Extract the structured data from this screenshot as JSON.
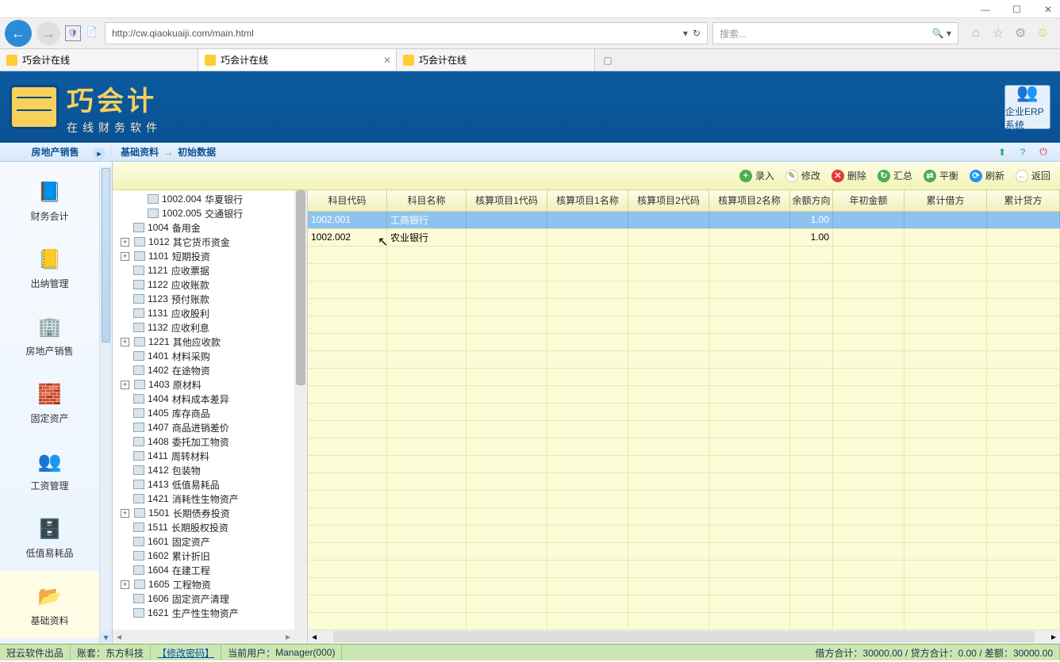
{
  "window": {
    "url": "http://cw.qiaokuaiji.com/main.html",
    "search_placeholder": "搜索..."
  },
  "tabs": [
    {
      "title": "巧会计在线",
      "active": false
    },
    {
      "title": "巧会计在线",
      "active": true
    },
    {
      "title": "巧会计在线",
      "active": false
    }
  ],
  "app": {
    "logo_main": "巧会计",
    "logo_sub": "在线财务软件",
    "erp_label": "企业ERP系统"
  },
  "module": "房地产销售",
  "breadcrumb": {
    "root": "基础资料",
    "leaf": "初始数据"
  },
  "left_nav": [
    {
      "label": "财务会计",
      "icon": "📘"
    },
    {
      "label": "出纳管理",
      "icon": "📒"
    },
    {
      "label": "房地产销售",
      "icon": "🏢"
    },
    {
      "label": "固定资产",
      "icon": "🧱"
    },
    {
      "label": "工资管理",
      "icon": "👥"
    },
    {
      "label": "低值易耗品",
      "icon": "🗄️"
    },
    {
      "label": "基础资料",
      "icon": "📂",
      "active": true
    }
  ],
  "toolbar": [
    {
      "label": "录入",
      "color": "green",
      "glyph": "+"
    },
    {
      "label": "修改",
      "color": "yel",
      "glyph": "✎"
    },
    {
      "label": "删除",
      "color": "red",
      "glyph": "✕"
    },
    {
      "label": "汇总",
      "color": "grn2",
      "glyph": "↻"
    },
    {
      "label": "平衡",
      "color": "grn2",
      "glyph": "⇄"
    },
    {
      "label": "刷新",
      "color": "blue",
      "glyph": "⟳"
    },
    {
      "label": "返回",
      "color": "yel",
      "glyph": "←"
    }
  ],
  "tree": [
    {
      "level": 2,
      "code": "1002.004",
      "name": "华夏银行"
    },
    {
      "level": 2,
      "code": "1002.005",
      "name": "交通银行"
    },
    {
      "level": 1,
      "code": "1004",
      "name": "备用金"
    },
    {
      "level": 1,
      "code": "1012",
      "name": "其它货币资金",
      "exp": "+"
    },
    {
      "level": 1,
      "code": "1101",
      "name": "短期投资",
      "exp": "+"
    },
    {
      "level": 1,
      "code": "1121",
      "name": "应收票据"
    },
    {
      "level": 1,
      "code": "1122",
      "name": "应收账款"
    },
    {
      "level": 1,
      "code": "1123",
      "name": "预付账款"
    },
    {
      "level": 1,
      "code": "1131",
      "name": "应收股利"
    },
    {
      "level": 1,
      "code": "1132",
      "name": "应收利息"
    },
    {
      "level": 1,
      "code": "1221",
      "name": "其他应收款",
      "exp": "+"
    },
    {
      "level": 1,
      "code": "1401",
      "name": "材料采购"
    },
    {
      "level": 1,
      "code": "1402",
      "name": "在途物资"
    },
    {
      "level": 1,
      "code": "1403",
      "name": "原材料",
      "exp": "+"
    },
    {
      "level": 1,
      "code": "1404",
      "name": "材料成本差异"
    },
    {
      "level": 1,
      "code": "1405",
      "name": "库存商品"
    },
    {
      "level": 1,
      "code": "1407",
      "name": "商品进销差价"
    },
    {
      "level": 1,
      "code": "1408",
      "name": "委托加工物资"
    },
    {
      "level": 1,
      "code": "1411",
      "name": "周转材料"
    },
    {
      "level": 1,
      "code": "1412",
      "name": "包装物"
    },
    {
      "level": 1,
      "code": "1413",
      "name": "低值易耗品"
    },
    {
      "level": 1,
      "code": "1421",
      "name": "消耗性生物资产"
    },
    {
      "level": 1,
      "code": "1501",
      "name": "长期债券投资",
      "exp": "+"
    },
    {
      "level": 1,
      "code": "1511",
      "name": "长期股权投资"
    },
    {
      "level": 1,
      "code": "1601",
      "name": "固定资产"
    },
    {
      "level": 1,
      "code": "1602",
      "name": "累计折旧"
    },
    {
      "level": 1,
      "code": "1604",
      "name": "在建工程"
    },
    {
      "level": 1,
      "code": "1605",
      "name": "工程物资",
      "exp": "+"
    },
    {
      "level": 1,
      "code": "1606",
      "name": "固定资产清理"
    },
    {
      "level": 1,
      "code": "1621",
      "name": "生产性生物资产"
    }
  ],
  "grid": {
    "columns": [
      "科目代码",
      "科目名称",
      "核算项目1代码",
      "核算项目1名称",
      "核算项目2代码",
      "核算项目2名称",
      "余额方向",
      "年初金额",
      "累计借方",
      "累计贷方"
    ],
    "rows": [
      {
        "code": "1002.001",
        "name": "工商银行",
        "dir": "1.00",
        "selected": true
      },
      {
        "code": "1002.002",
        "name": "农业银行",
        "dir": "1.00"
      }
    ]
  },
  "status": {
    "vendor": "冠云软件出品",
    "account_set_label": "账套：",
    "account_set": "东方科技",
    "change_pwd": "【修改密码】",
    "user_label": "当前用户：",
    "user": "Manager(000)",
    "totals": "借方合计：30000.00 / 贷方合计：0.00 / 差额：30000.00"
  }
}
